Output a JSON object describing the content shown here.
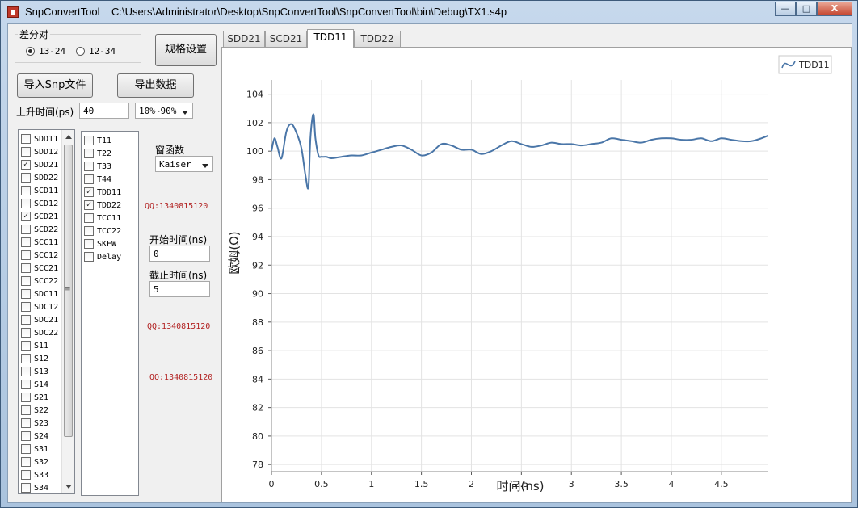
{
  "window": {
    "app_name": "SnpConvertTool",
    "file_path": "C:\\Users\\Administrator\\Desktop\\SnpConvertTool\\SnpConvertTool\\bin\\Debug\\TX1.s4p",
    "min_glyph": "—",
    "max_glyph": "□",
    "close_glyph": "X"
  },
  "diffpair": {
    "title": "差分对",
    "options": [
      "13-24",
      "12-34"
    ],
    "selected": "13-24"
  },
  "buttons": {
    "spec": "规格设置",
    "import": "导入Snp文件",
    "export": "导出数据"
  },
  "rise_time": {
    "label": "上升时间(ps)",
    "value": "40",
    "range": "10%~90%"
  },
  "params_list": [
    {
      "name": "SDD11",
      "checked": false
    },
    {
      "name": "SDD12",
      "checked": false
    },
    {
      "name": "SDD21",
      "checked": true
    },
    {
      "name": "SDD22",
      "checked": false
    },
    {
      "name": "SCD11",
      "checked": false
    },
    {
      "name": "SCD12",
      "checked": false
    },
    {
      "name": "SCD21",
      "checked": true
    },
    {
      "name": "SCD22",
      "checked": false
    },
    {
      "name": "SCC11",
      "checked": false
    },
    {
      "name": "SCC12",
      "checked": false
    },
    {
      "name": "SCC21",
      "checked": false
    },
    {
      "name": "SCC22",
      "checked": false
    },
    {
      "name": "SDC11",
      "checked": false
    },
    {
      "name": "SDC12",
      "checked": false
    },
    {
      "name": "SDC21",
      "checked": false
    },
    {
      "name": "SDC22",
      "checked": false
    },
    {
      "name": "S11",
      "checked": false
    },
    {
      "name": "S12",
      "checked": false
    },
    {
      "name": "S13",
      "checked": false
    },
    {
      "name": "S14",
      "checked": false
    },
    {
      "name": "S21",
      "checked": false
    },
    {
      "name": "S22",
      "checked": false
    },
    {
      "name": "S23",
      "checked": false
    },
    {
      "name": "S24",
      "checked": false
    },
    {
      "name": "S31",
      "checked": false
    },
    {
      "name": "S32",
      "checked": false
    },
    {
      "name": "S33",
      "checked": false
    },
    {
      "name": "S34",
      "checked": false
    }
  ],
  "td_list": [
    {
      "name": "T11",
      "checked": false
    },
    {
      "name": "T22",
      "checked": false
    },
    {
      "name": "T33",
      "checked": false
    },
    {
      "name": "T44",
      "checked": false
    },
    {
      "name": "TDD11",
      "checked": true
    },
    {
      "name": "TDD22",
      "checked": true
    },
    {
      "name": "TCC11",
      "checked": false
    },
    {
      "name": "TCC22",
      "checked": false
    },
    {
      "name": "SKEW",
      "checked": false
    },
    {
      "name": "Delay",
      "checked": false
    }
  ],
  "window_func": {
    "label": "窗函数",
    "value": "Kaiser"
  },
  "qq_text": "QQ:1340815120",
  "start_time": {
    "label": "开始时间(ns)",
    "value": "0"
  },
  "end_time": {
    "label": "截止时间(ns)",
    "value": "5"
  },
  "tabs": [
    {
      "label": "SDD21",
      "active": false
    },
    {
      "label": "SCD21",
      "active": false
    },
    {
      "label": "TDD11",
      "active": true
    },
    {
      "label": "TDD22",
      "active": false
    }
  ],
  "chart_data": {
    "type": "line",
    "xlabel": "时间(ns)",
    "ylabel": "欧姆(Ω)",
    "xlim": [
      0,
      4.97
    ],
    "ylim": [
      77.5,
      105
    ],
    "xticks": [
      0,
      0.5,
      1,
      1.5,
      2,
      2.5,
      3,
      3.5,
      4,
      4.5
    ],
    "xtick_labels": [
      "0",
      "0.5",
      "1",
      "1.5",
      "2",
      "2.5",
      "3",
      "3.5",
      "4",
      "4.5"
    ],
    "yticks": [
      78,
      80,
      82,
      84,
      86,
      88,
      90,
      92,
      94,
      96,
      98,
      100,
      102,
      104
    ],
    "grid": true,
    "legend": "top-right",
    "series": [
      {
        "name": "TDD11",
        "color": "#4a76a8",
        "x": [
          0,
          0.03,
          0.06,
          0.1,
          0.15,
          0.2,
          0.25,
          0.3,
          0.34,
          0.37,
          0.39,
          0.42,
          0.44,
          0.47,
          0.5,
          0.55,
          0.6,
          0.7,
          0.8,
          0.9,
          1.0,
          1.1,
          1.2,
          1.3,
          1.4,
          1.5,
          1.6,
          1.7,
          1.8,
          1.9,
          2.0,
          2.1,
          2.2,
          2.3,
          2.4,
          2.5,
          2.6,
          2.7,
          2.8,
          2.9,
          3.0,
          3.1,
          3.2,
          3.3,
          3.4,
          3.5,
          3.6,
          3.7,
          3.8,
          3.9,
          4.0,
          4.1,
          4.2,
          4.3,
          4.4,
          4.5,
          4.6,
          4.7,
          4.8,
          4.9,
          4.97
        ],
        "values": [
          100.0,
          100.9,
          100.3,
          99.5,
          101.4,
          101.9,
          101.3,
          100.2,
          98.3,
          97.5,
          101.0,
          102.6,
          100.9,
          99.7,
          99.6,
          99.6,
          99.5,
          99.6,
          99.7,
          99.7,
          99.9,
          100.1,
          100.3,
          100.4,
          100.1,
          99.7,
          99.9,
          100.5,
          100.4,
          100.1,
          100.1,
          99.8,
          100.0,
          100.4,
          100.7,
          100.5,
          100.3,
          100.4,
          100.6,
          100.5,
          100.5,
          100.4,
          100.5,
          100.6,
          100.9,
          100.8,
          100.7,
          100.6,
          100.8,
          100.9,
          100.9,
          100.8,
          100.8,
          100.9,
          100.7,
          100.9,
          100.8,
          100.7,
          100.7,
          100.9,
          101.1
        ]
      }
    ]
  }
}
